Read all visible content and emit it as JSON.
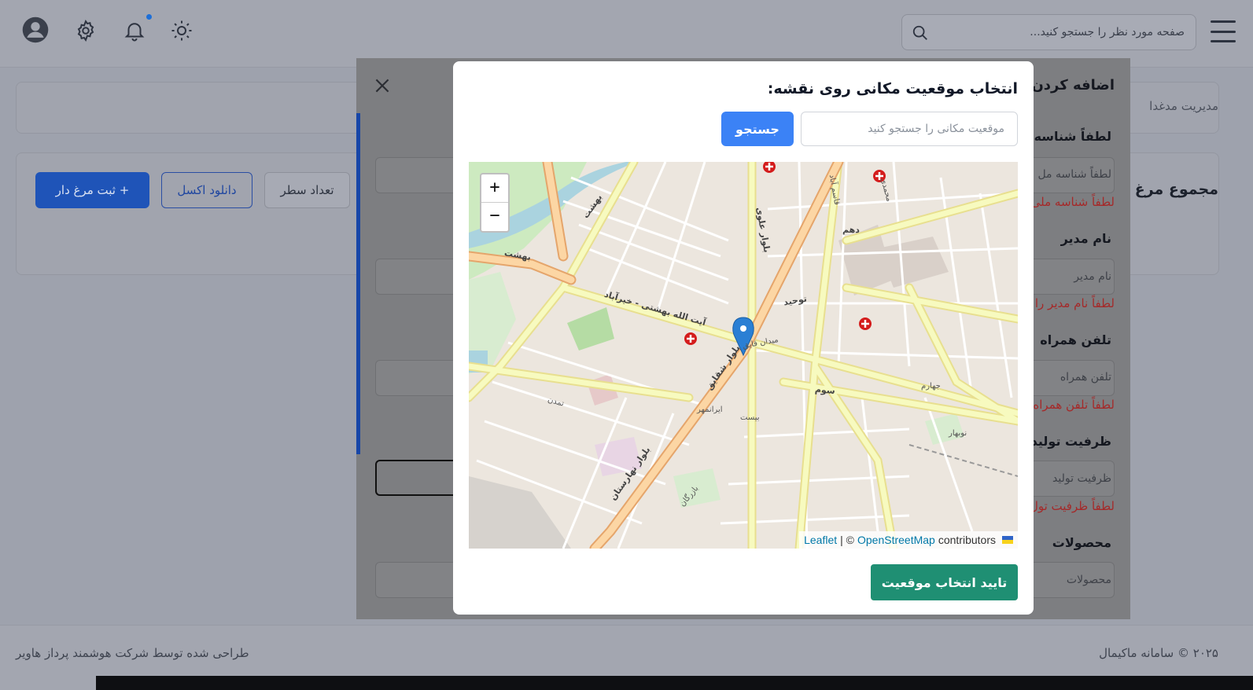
{
  "header": {
    "search_placeholder": "صفحه مورد نظر را جستجو کنید..."
  },
  "page": {
    "breadcrumb": "مدیریت مدغدا",
    "section_title": "مجموع مرغ",
    "buttons": {
      "add": "ثبت مرغ دار +",
      "excel": "دانلود اکسل",
      "rows": "تعداد سطر"
    }
  },
  "form_modal": {
    "title": "اضافه کردن م",
    "fields": [
      {
        "label": "لطفاً شناسه مل",
        "placeholder": "لطفاً شناسه مل",
        "error": "لطفاً شناسه ملی"
      },
      {
        "label": "نام مدیر",
        "placeholder": "نام مدیر",
        "error": "لطفاً نام مدیر را"
      },
      {
        "label": "تلفن همراه",
        "placeholder": "تلفن همراه",
        "error": "لطفاً تلفن همراه"
      },
      {
        "label": "ظرفیت تولید",
        "placeholder": "ظرفیت تولید",
        "error": "لطفاً ظرفیت تول"
      },
      {
        "label": "محصولات",
        "placeholder": "محصولات",
        "error": ""
      }
    ]
  },
  "map_modal": {
    "title": "انتخاب موقعیت مکانی روی نقشه:",
    "search_placeholder": "موقعیت مکانی را جستجو کنید",
    "search_button": "جستجو",
    "zoom_in": "+",
    "zoom_out": "−",
    "attribution": {
      "leaflet": "Leaflet",
      "separator": "| ©",
      "osm": "OpenStreetMap",
      "contributors": "contributors"
    },
    "confirm_button": "تایید انتخاب موقعیت",
    "map_labels": {
      "behesht": "بهشت",
      "behesht2": "بهشت",
      "ayatollah": "آیت الله بهشتی - خیرآباد",
      "shaghayegh": "بلوار شقایق",
      "alavi": "بلوار علوی",
      "naharestan": "بلوار نهارستان",
      "tamadon": "تمدن",
      "bazargan": "بازرگان",
      "sevom": "سوم",
      "tohid": "توحید",
      "dahom": "دهم",
      "ghasem_abad": "قاسم آباد",
      "meydan": "میدان قایق",
      "mohammadi": "محمدی",
      "jahad": "جهارم",
      "irnamehr": "ایرانمهر",
      "nobahar": "نوبهار",
      "bist": "بیست"
    }
  },
  "footer": {
    "left": "طراحی شده توسط شرکت هوشمند پرداز هاویر",
    "right": "۲۰۲۵ © سامانه ماکیمال"
  },
  "colors": {
    "primary": "#3b82f6",
    "confirm": "#1f8f73",
    "error": "#dc2626",
    "marker": "#2a7fd4"
  }
}
